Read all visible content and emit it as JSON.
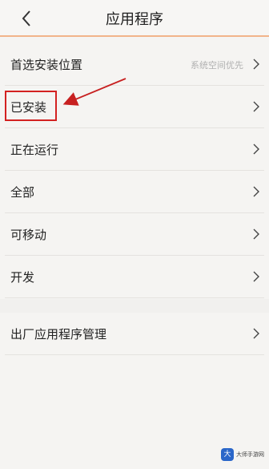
{
  "header": {
    "title": "应用程序",
    "back_icon": "chevron-left-icon"
  },
  "settings": {
    "preferred_install_location": {
      "label": "首选安装位置",
      "value": "系统空间优先"
    },
    "installed": {
      "label": "已安装"
    },
    "running": {
      "label": "正在运行"
    },
    "all": {
      "label": "全部"
    },
    "movable": {
      "label": "可移动"
    },
    "developer": {
      "label": "开发"
    },
    "factory_apps": {
      "label": "出厂应用程序管理"
    }
  },
  "annotation": {
    "highlight_color": "#d32121"
  },
  "watermark": {
    "logo": "大",
    "name": "大师手游网"
  },
  "colors": {
    "accent_line": "#f2b48a",
    "background": "#f5f4f2"
  }
}
